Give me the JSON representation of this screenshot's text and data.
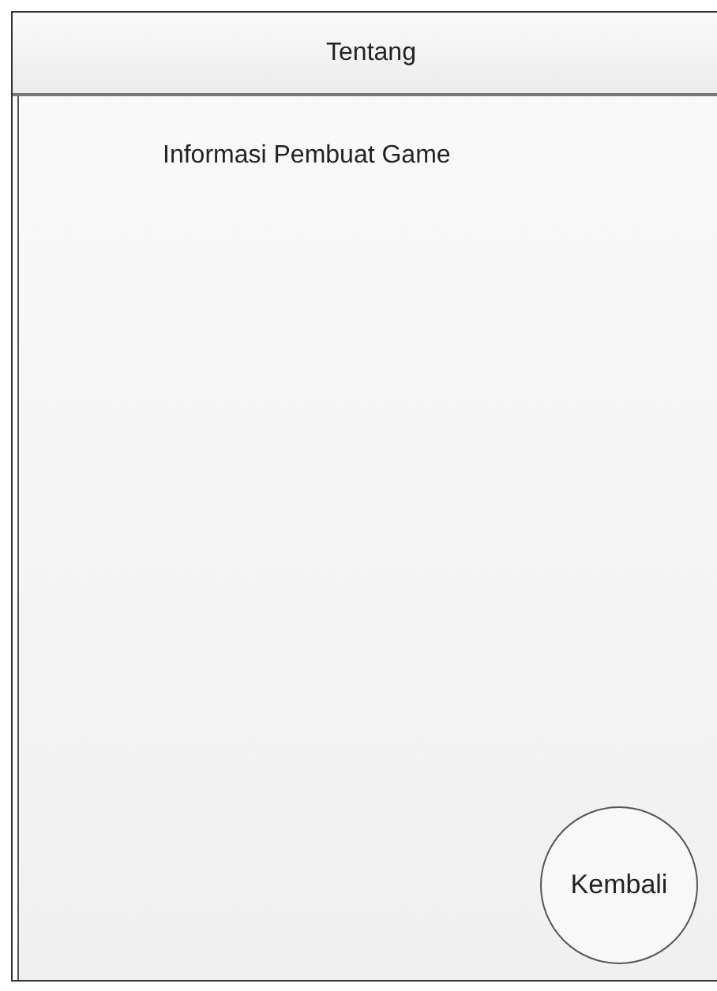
{
  "header": {
    "title": "Tentang"
  },
  "content": {
    "text": "Informasi Pembuat Game"
  },
  "back_button": {
    "label": "Kembali"
  }
}
